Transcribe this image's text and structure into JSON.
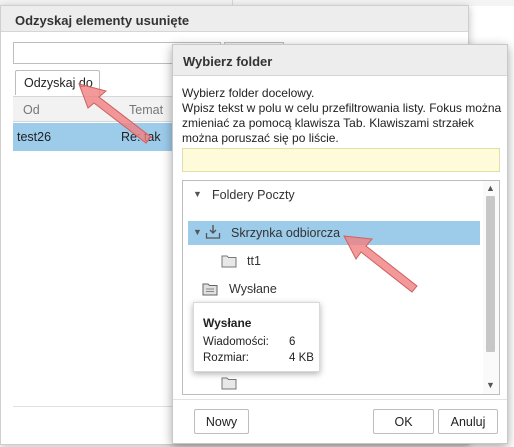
{
  "restore_dialog": {
    "title": "Odzyskaj elementy usunięte",
    "restore_to_label": "Odzyskaj do",
    "columns": [
      "Od",
      "Temat"
    ],
    "rows": [
      {
        "from": "test26",
        "subject": "Re: tak"
      }
    ]
  },
  "folder_dialog": {
    "title": "Wybierz folder",
    "instructions": [
      "Wybierz folder docelowy.",
      "Wpisz tekst w polu w celu przefiltrowania listy. Fokus można",
      "zmieniać za pomocą klawisza Tab. Klawiszami strzałek",
      "można poruszać się po liście."
    ],
    "filter_value": "",
    "tree": {
      "root_label": "Foldery Poczty",
      "items": [
        {
          "label": "Skrzynka odbiorcza",
          "icon": "inbox-icon",
          "selected": true,
          "expanded": true
        },
        {
          "label": "tt1",
          "icon": "folder-icon",
          "selected": false
        },
        {
          "label": "Wysłane",
          "icon": "sent-icon",
          "selected": false
        }
      ]
    },
    "tooltip": {
      "title": "Wysłane",
      "messages_label": "Wiadomości:",
      "messages_value": "6",
      "size_label": "Rozmiar:",
      "size_value": "4 KB"
    },
    "buttons": {
      "new": "Nowy",
      "ok": "OK",
      "cancel": "Anuluj"
    }
  },
  "colors": {
    "selection": "#9dcbea",
    "filter_bg": "#fdfbd9",
    "pointer_arrow": "#f08080"
  }
}
